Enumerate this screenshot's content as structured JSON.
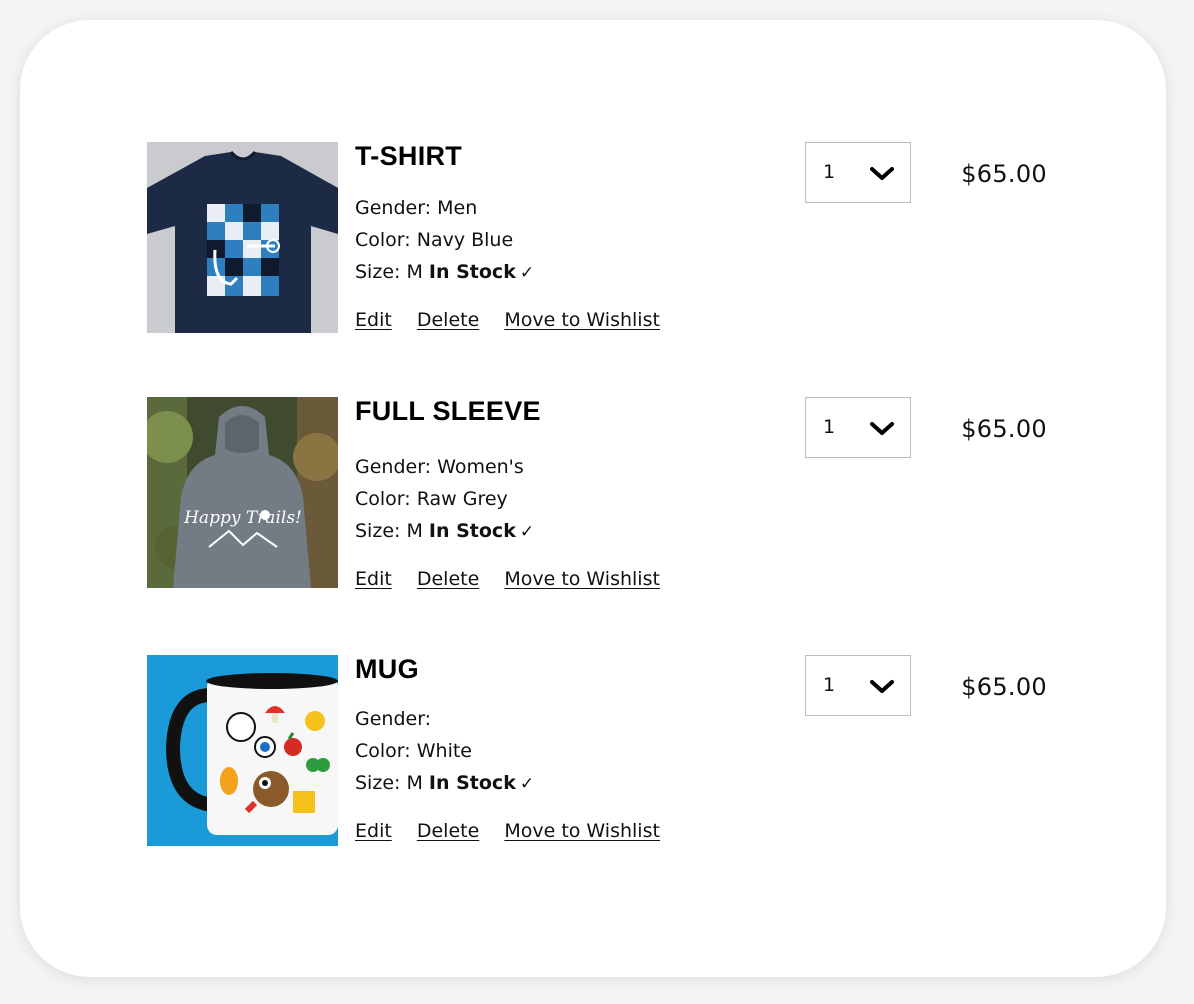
{
  "cart": {
    "items": [
      {
        "title": "T-SHIRT",
        "gender_label": "Gender:",
        "gender_value": "Men",
        "color_label": "Color:",
        "color_value": "Navy Blue",
        "size_label": "Size:",
        "size_value": "M",
        "stock_label": "In Stock",
        "edit_label": "Edit",
        "delete_label": "Delete",
        "wishlist_label": "Move to Wishlist",
        "quantity": "1",
        "price": "$65.00",
        "image_icon": "tshirt-image"
      },
      {
        "title": "FULL SLEEVE",
        "gender_label": "Gender:",
        "gender_value": "Women's",
        "color_label": "Color:",
        "color_value": "Raw Grey",
        "size_label": "Size:",
        "size_value": "M",
        "stock_label": "In Stock",
        "edit_label": "Edit",
        "delete_label": "Delete",
        "wishlist_label": "Move to Wishlist",
        "quantity": "1",
        "price": "$65.00",
        "image_icon": "hoodie-image",
        "image_text": "Happy Trails!"
      },
      {
        "title": "MUG",
        "gender_label": "Gender:",
        "gender_value": "",
        "color_label": "Color:",
        "color_value": "White",
        "size_label": "Size:",
        "size_value": "M",
        "stock_label": "In Stock",
        "edit_label": "Edit",
        "delete_label": "Delete",
        "wishlist_label": "Move to Wishlist",
        "quantity": "1",
        "price": "$65.00",
        "image_icon": "mug-image"
      }
    ]
  },
  "icons": {
    "check": "checkmark-icon",
    "chevron": "chevron-down-icon"
  },
  "colors": {
    "tshirt_bg": "#c9cbce",
    "tshirt": "#1c2a45",
    "tshirt_accent": "#2e7fbf",
    "forest": "#3f4a2e",
    "hoodie": "#737c84",
    "mug_bg": "#1a9bd7",
    "mug": "#f7f7f7"
  }
}
